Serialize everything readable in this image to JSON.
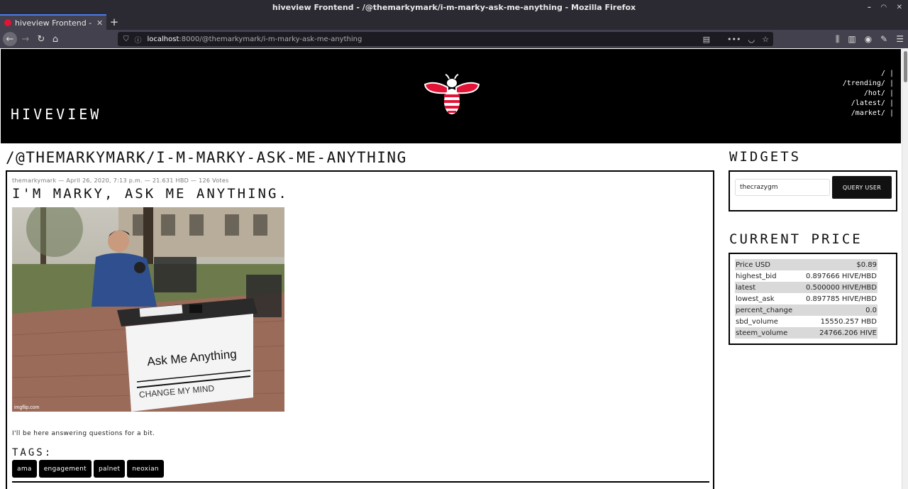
{
  "browser": {
    "window_title": "hiveview Frontend - /@themarkymark/i-m-marky-ask-me-anything - Mozilla Firefox",
    "tab_title": "hiveview Frontend - /@themarkymark/i-m-marky-ask-me-anything",
    "url_host": "localhost",
    "url_rest": ":8000/@themarkymark/i-m-marky-ask-me-anything"
  },
  "header": {
    "brand": "HIVEVIEW",
    "nav": [
      "/ |",
      "/trending/ |",
      "/hot/ |",
      "/latest/ |",
      "/market/ |"
    ]
  },
  "page_title": "/@THEMARKYMARK/I-M-MARKY-ASK-ME-ANYTHING",
  "post": {
    "meta": "themarkymark — April 26, 2020, 7:13 p.m. — 21.631 HBD — 126 Votes",
    "title": "I'M MARKY, ASK ME ANYTHING.",
    "image_sign_main": "Ask Me Anything",
    "image_sign_struck": "CHANGE MY MIND",
    "image_watermark": "imgflip.com",
    "body": "I'll be here answering questions for a bit.",
    "tags_label": "TAGS:",
    "tags": [
      "ama",
      "engagement",
      "palnet",
      "neoxian"
    ]
  },
  "widgets": {
    "title": "WIDGETS",
    "user_input_value": "thecrazygm",
    "query_button": "QUERY USER"
  },
  "price": {
    "title": "CURRENT PRICE",
    "rows": [
      {
        "label": "Price USD",
        "value": "$0.89"
      },
      {
        "label": "highest_bid",
        "value": "0.897666 HIVE/HBD"
      },
      {
        "label": "latest",
        "value": "0.500000 HIVE/HBD"
      },
      {
        "label": "lowest_ask",
        "value": "0.897785 HIVE/HBD"
      },
      {
        "label": "percent_change",
        "value": "0.0"
      },
      {
        "label": "sbd_volume",
        "value": "15550.257 HBD"
      },
      {
        "label": "steem_volume",
        "value": "24766.206 HIVE"
      }
    ]
  },
  "colors": {
    "accent": "#e31337",
    "header_bg": "#000000"
  }
}
